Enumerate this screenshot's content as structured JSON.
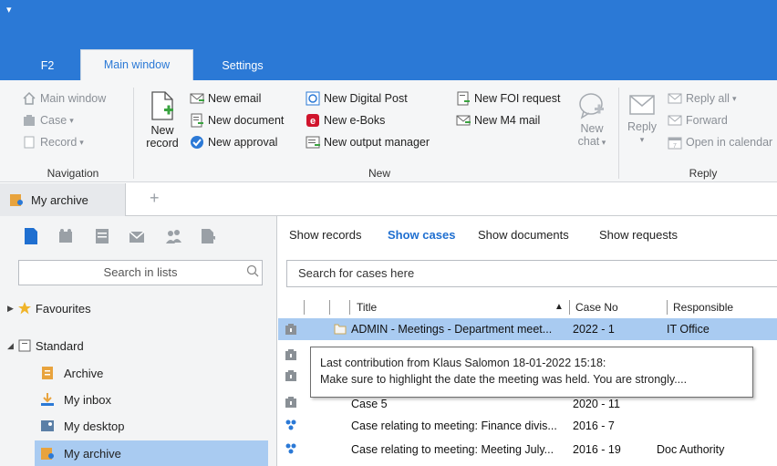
{
  "ribbon_tabs": [
    "F2",
    "Main window",
    "Settings"
  ],
  "ribbon": {
    "navigation": {
      "items": [
        "Main window",
        "Case",
        "Record"
      ],
      "group_label": "Navigation"
    },
    "new": {
      "new_record_line1": "New",
      "new_record_line2": "record",
      "col1": [
        "New email",
        "New document",
        "New approval"
      ],
      "col2": [
        "New Digital Post",
        "New e-Boks",
        "New output manager"
      ],
      "col3": [
        "New FOI request",
        "New M4 mail"
      ],
      "new_chat_line1": "New",
      "new_chat_line2": "chat",
      "group_label": "New"
    },
    "reply": {
      "reply_label": "Reply",
      "items": [
        "Reply all",
        "Forward",
        "Open in calendar"
      ],
      "group_label": "Reply"
    }
  },
  "tabs": {
    "active": "My archive",
    "add": "+"
  },
  "left": {
    "search_placeholder": "Search in lists",
    "favourites": "Favourites",
    "standard": "Standard",
    "items": [
      "Archive",
      "My inbox",
      "My desktop",
      "My archive"
    ]
  },
  "main": {
    "view_tabs": [
      "Show records",
      "Show cases",
      "Show documents",
      "Show requests"
    ],
    "active_view": "Show cases",
    "search_placeholder": "Search for cases here",
    "columns": {
      "title": "Title",
      "case_no": "Case No",
      "responsible": "Responsible",
      "sort_indicator": "▲"
    },
    "rows": [
      {
        "title": "ADMIN - Meetings - Department meet...",
        "case_no": "2022 - 1",
        "responsible": "IT Office"
      },
      {
        "title": "Case 5",
        "case_no": "2020 - 11",
        "responsible": ""
      },
      {
        "title": "Case relating to meeting: Finance divis...",
        "case_no": "2016 - 7",
        "responsible": ""
      },
      {
        "title": "Case relating to meeting: Meeting July...",
        "case_no": "2016 - 19",
        "responsible": "Doc Authority"
      }
    ],
    "tooltip": {
      "line1": "Last contribution from Klaus Salomon 18-01-2022 15:18:",
      "line2": "Make sure to highlight the date the meeting was held. You are strongly...."
    }
  },
  "colors": {
    "title_bar": "#2b79d6",
    "selection": "#a9cbf1",
    "accent_text": "#1f6fd0",
    "eboks_red": "#d0142c"
  }
}
